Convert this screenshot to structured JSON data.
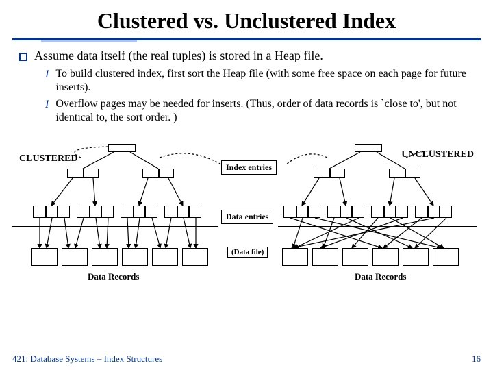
{
  "title": "Clustered vs. Unclustered Index",
  "main_bullet": "Assume data itself (the real tuples) is stored in a Heap file.",
  "sub_bullets": [
    "To build clustered index, first sort the Heap file (with some free space on each page for future inserts).",
    "Overflow pages may be needed for inserts.  (Thus, order of data records is `close to', but not identical to, the sort order. )"
  ],
  "diagram": {
    "left_label": "CLUSTERED",
    "right_label": "UNCLUSTERED",
    "mid_labels": {
      "index_entries": "Index entries",
      "data_entries": "Data entries",
      "data_file": "(Data file)"
    },
    "records_label": "Data Records"
  },
  "footer": {
    "left": "421: Database Systems – Index Structures",
    "right": "16"
  }
}
